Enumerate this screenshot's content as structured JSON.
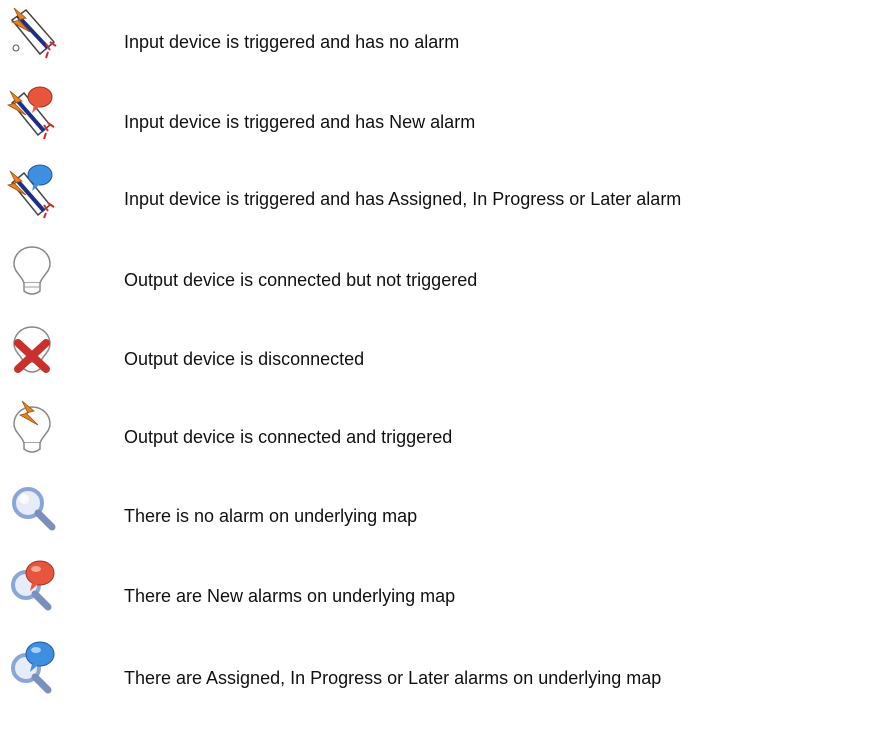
{
  "legend": {
    "items": [
      {
        "icon": "input-triggered-no-alarm-icon",
        "text": "Input device is triggered and has no alarm"
      },
      {
        "icon": "input-triggered-new-alarm-icon",
        "text": "Input device is triggered and has New alarm"
      },
      {
        "icon": "input-triggered-assigned-alarm-icon",
        "text": "Input device is triggered and has Assigned, In Progress or Later alarm"
      },
      {
        "icon": "output-connected-not-triggered-icon",
        "text": "Output device is connected but not triggered"
      },
      {
        "icon": "output-disconnected-icon",
        "text": "Output device is disconnected"
      },
      {
        "icon": "output-connected-triggered-icon",
        "text": "Output device is connected and triggered"
      },
      {
        "icon": "map-no-alarm-icon",
        "text": "There is no alarm on underlying map"
      },
      {
        "icon": "map-new-alarms-icon",
        "text": "There are New alarms on underlying map"
      },
      {
        "icon": "map-assigned-alarms-icon",
        "text": "There are Assigned, In Progress or Later alarms on underlying map"
      }
    ]
  },
  "colors": {
    "text": "#111111",
    "new_alarm_red": "#e8553d",
    "assigned_alarm_blue": "#3f8fe0",
    "lightning_orange": "#e8841f",
    "disconnect_red": "#c9302c",
    "magnifier_blue": "#8aa6d8"
  }
}
